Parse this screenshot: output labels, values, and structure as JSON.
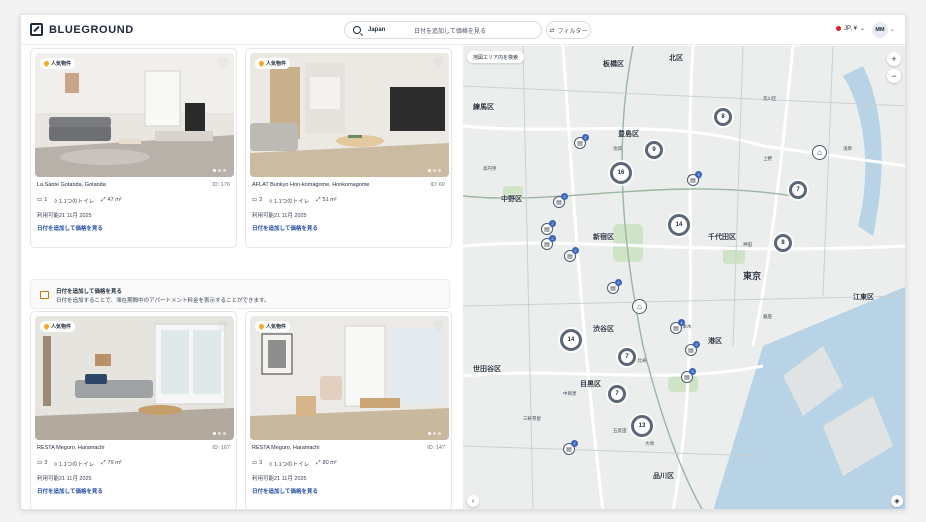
{
  "header": {
    "brand": "BLUEGROUND",
    "search_location": "Japan",
    "search_dates": "日付を追加して価格を見る",
    "filter_label": "フィルター",
    "locale": "JP, ¥",
    "user_initials": "MM"
  },
  "listings": [
    {
      "badge": "人気物件",
      "name": "La Sante Gotanda, Gotanda",
      "id": "ID: 176",
      "beds": "1",
      "toilets": "1.1つのトイレ",
      "area": "47 m²",
      "availability": "利用可能21 11月 2025",
      "link": "日付を追加して価格を見る"
    },
    {
      "badge": "人気物件",
      "name": "AFLAT Bunkyo Hon-komagome, Honkomagome",
      "id": "ID: 60",
      "beds": "2",
      "toilets": "1.1つのトイレ",
      "area": "51 m²",
      "availability": "利用可能21 11月 2025",
      "link": "日付を追加して価格を見る"
    },
    {
      "badge": "人気物件",
      "name": "RESTA Meguro, Haramachi",
      "id": "ID: 167",
      "beds": "3",
      "toilets": "1.1つのトイレ",
      "area": "79 m²",
      "availability": "利用可能21 11月 2025",
      "link": "日付を追加して価格を見る"
    },
    {
      "badge": "人気物件",
      "name": "RESTA Meguro, Haramachi",
      "id": "ID: 147",
      "beds": "3",
      "toilets": "1.1つのトイレ",
      "area": "80 m²",
      "availability": "利用可能21 11月 2025",
      "link": "日付を追加して価格を見る"
    }
  ],
  "banner": {
    "title": "日付を追加して価格を見る",
    "text": "日付を追加することで、滞在期間中のアパートメント料金を表示することができます。"
  },
  "map": {
    "search_here": "地図エリア内を検索",
    "districts": [
      "北区",
      "板橋区",
      "練馬区",
      "豊島区",
      "中野区",
      "新宿区",
      "千代田区",
      "東京",
      "江東区",
      "渋谷区",
      "港区",
      "世田谷区",
      "目黒区",
      "品川区"
    ],
    "small_labels": [
      "荒川区",
      "上野",
      "文京区",
      "池袋",
      "神田",
      "銀座",
      "六本木",
      "恵比寿",
      "五反田",
      "大崎",
      "中目黒",
      "三軒茶屋",
      "高円寺",
      "浅草"
    ],
    "clusters": [
      "8",
      "9",
      "16",
      "14",
      "7",
      "8",
      "14",
      "7",
      "7",
      "13"
    ],
    "pin_counts": [
      "2",
      "2",
      "3",
      "2",
      "2",
      "2",
      "4",
      "2",
      "3",
      "2",
      "2"
    ]
  },
  "colors": {
    "accent": "#1f4aa8",
    "cluster_ring": "#5c6877",
    "water": "#b9d3e6",
    "park": "#cfe4c6"
  }
}
